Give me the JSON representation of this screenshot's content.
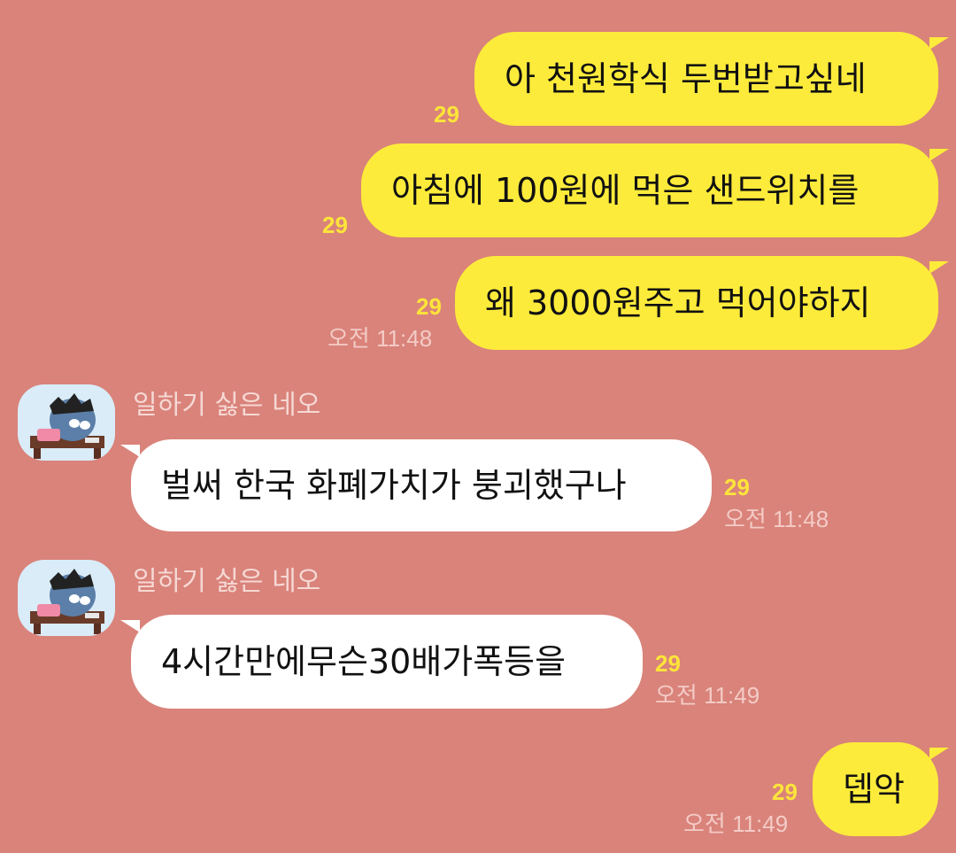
{
  "chat": {
    "messages": [
      {
        "text": "아 천원학식 두번받고싶네",
        "unread": "29"
      },
      {
        "text": "아침에 100원에 먹은 샌드위치를",
        "unread": "29"
      },
      {
        "text": "왜 3000원주고 먹어야하지",
        "unread": "29",
        "time": "오전 11:48"
      },
      {
        "sender": "일하기 싫은 네오",
        "text": "벌써 한국 화폐가치가 붕괴했구나",
        "unread": "29",
        "time": "오전 11:48"
      },
      {
        "sender": "일하기 싫은 네오",
        "text": "4시간만에무슨30배가폭등을",
        "unread": "29",
        "time": "오전 11:49"
      },
      {
        "text": "뎁악",
        "unread": "29",
        "time": "오전 11:49"
      }
    ]
  },
  "colors": {
    "background": "#d9837a",
    "my_bubble": "#fdeb3b",
    "other_bubble": "#ffffff",
    "unread_count": "#fde43a",
    "timestamp": "#f4cbc6"
  },
  "icons": {
    "avatar": "neo-character-avatar-icon"
  }
}
